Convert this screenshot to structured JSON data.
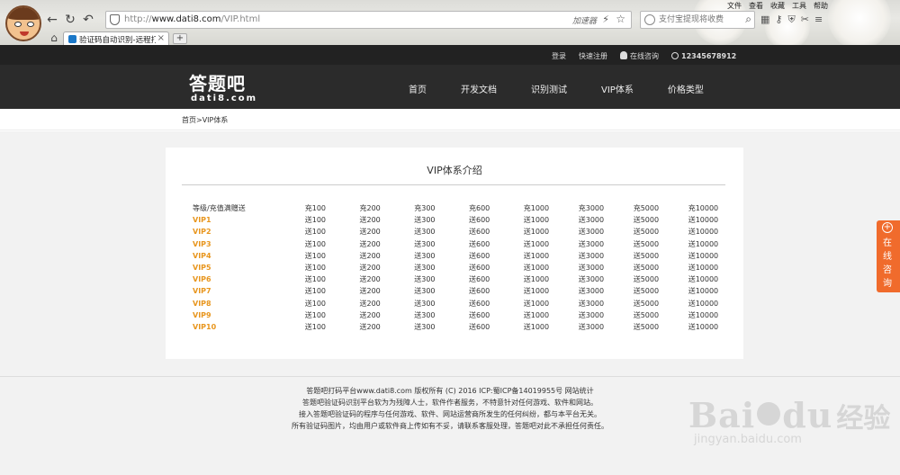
{
  "browser": {
    "url_prefix": "http://",
    "url_host": "www.dati8.com",
    "url_path": "/VIP.html",
    "accelerator_label": "加速器",
    "search_placeholder": "支付宝提现将收费",
    "menu": [
      "文件",
      "查看",
      "收藏",
      "工具",
      "帮助"
    ],
    "tab_title": "验证码自动识别-远程打码",
    "new_tab": "+",
    "tab_close": "×",
    "back": "←",
    "forward": "↻",
    "undo": "↶",
    "home": "⌂"
  },
  "topbar": {
    "login": "登录",
    "register": "快速注册",
    "consult": "在线咨询",
    "phone": "12345678912"
  },
  "logo": {
    "cn": "答题吧",
    "en": "dati8.com"
  },
  "nav": [
    "首页",
    "开发文档",
    "识别测试",
    "VIP体系",
    "价格类型"
  ],
  "breadcrumb": "首页>VIP体系",
  "card_title": "VIP体系介绍",
  "table": {
    "header": [
      "等级/充值满赠送",
      "充100",
      "充200",
      "充300",
      "充600",
      "充1000",
      "充3000",
      "充5000",
      "充10000"
    ],
    "rows": [
      [
        "VIP1",
        "送100",
        "送200",
        "送300",
        "送600",
        "送1000",
        "送3000",
        "送5000",
        "送10000"
      ],
      [
        "VIP2",
        "送100",
        "送200",
        "送300",
        "送600",
        "送1000",
        "送3000",
        "送5000",
        "送10000"
      ],
      [
        "VIP3",
        "送100",
        "送200",
        "送300",
        "送600",
        "送1000",
        "送3000",
        "送5000",
        "送10000"
      ],
      [
        "VIP4",
        "送100",
        "送200",
        "送300",
        "送600",
        "送1000",
        "送3000",
        "送5000",
        "送10000"
      ],
      [
        "VIP5",
        "送100",
        "送200",
        "送300",
        "送600",
        "送1000",
        "送3000",
        "送5000",
        "送10000"
      ],
      [
        "VIP6",
        "送100",
        "送200",
        "送300",
        "送600",
        "送1000",
        "送3000",
        "送5000",
        "送10000"
      ],
      [
        "VIP7",
        "送100",
        "送200",
        "送300",
        "送600",
        "送1000",
        "送3000",
        "送5000",
        "送10000"
      ],
      [
        "VIP8",
        "送100",
        "送200",
        "送300",
        "送600",
        "送1000",
        "送3000",
        "送5000",
        "送10000"
      ],
      [
        "VIP9",
        "送100",
        "送200",
        "送300",
        "送600",
        "送1000",
        "送3000",
        "送5000",
        "送10000"
      ],
      [
        "VIP10",
        "送100",
        "送200",
        "送300",
        "送600",
        "送1000",
        "送3000",
        "送5000",
        "送10000"
      ]
    ]
  },
  "footer": [
    "答题吧打码平台www.dati8.com 版权所有 (C) 2016 ICP:蜀ICP备14019955号  网站统计",
    "答题吧验证码识别平台软为为残障人士，软件作者服务，不特意针对任何游戏、软件和网站。",
    "接入答题吧验证码的程序与任何游戏、软件、网站运营商所发生的任何纠纷，都与本平台无关。",
    "所有验证码图片，均由用户或软件商上传如有不妥，请联系客服处理，答题吧对此不承担任何责任。"
  ],
  "side_consult": "在线咨询",
  "watermark": {
    "main": "Bai",
    "main2": "du",
    "jy": "经验",
    "sub": "jingyan.baidu.com"
  },
  "colors": {
    "vip_accent": "#e8961e",
    "consult_tab": "#f06b2c",
    "header_bg": "#2b2b2b"
  }
}
